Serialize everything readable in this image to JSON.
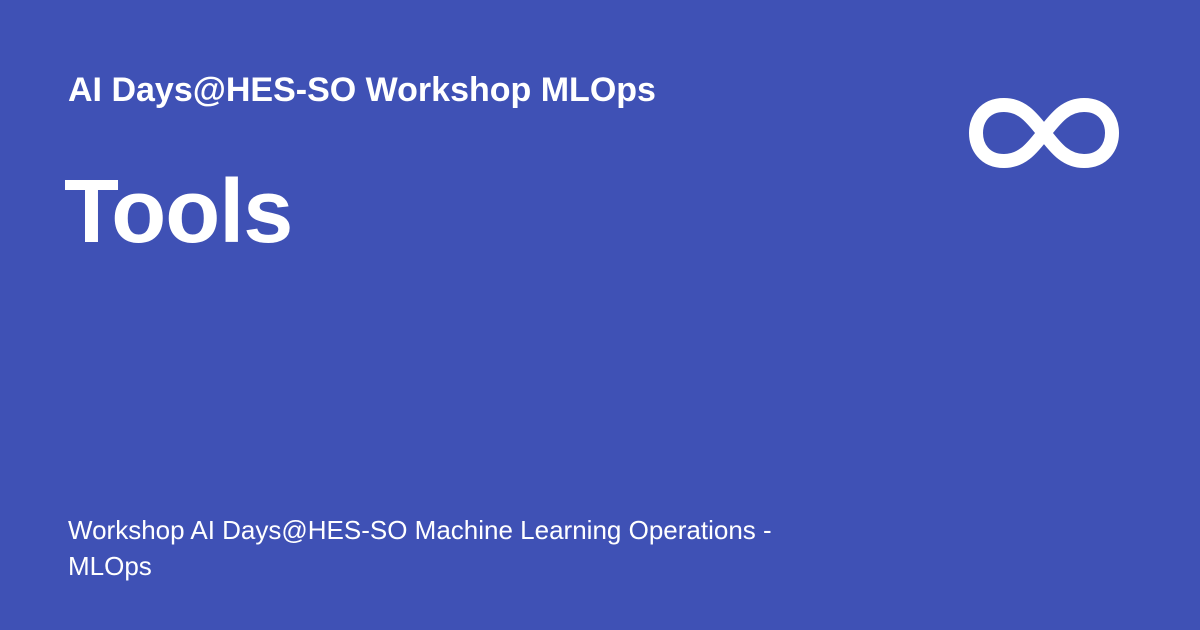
{
  "social_card": {
    "site_name": "AI Days@HES-SO Workshop MLOps",
    "page_title": "Tools",
    "description": "Workshop AI Days@HES-SO Machine Learning Operations - MLOps",
    "logo_icon": "infinity-icon",
    "colors": {
      "background": "#3f51b5",
      "text": "#ffffff"
    }
  }
}
